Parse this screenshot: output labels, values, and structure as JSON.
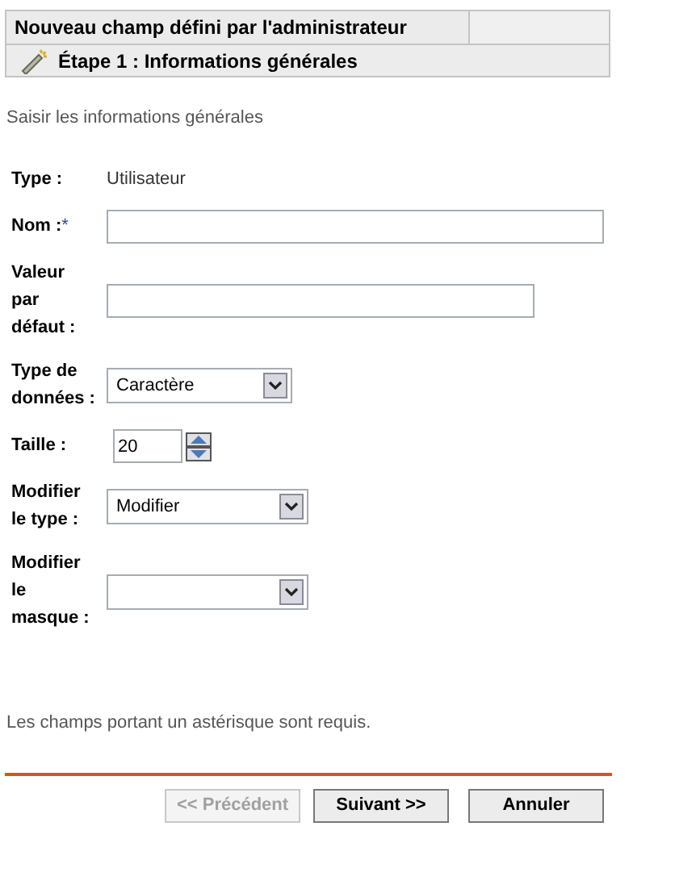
{
  "header": {
    "title": "Nouveau champ défini par l'administrateur",
    "step": "Étape 1 : Informations générales"
  },
  "instructions": "Saisir les informations générales",
  "fields": [
    {
      "kind": "text",
      "label": "Type :",
      "value": "Utilisateur"
    },
    {
      "kind": "input",
      "label": "Nom :",
      "required_mark": "*"
    },
    {
      "kind": "input",
      "label": "Valeur par défaut :"
    },
    {
      "kind": "select",
      "label": "Type de données :",
      "value": "Caractère"
    },
    {
      "kind": "spinner",
      "label": "Taille :",
      "value": "20"
    },
    {
      "kind": "select",
      "label": "Modifier le type :",
      "value": "Modifier"
    },
    {
      "kind": "select",
      "label": "Modifier le masque :"
    }
  ],
  "required_note": "Les champs portant un astérisque sont requis.",
  "buttons": [
    {
      "label": "<< Précédent",
      "disabled": true
    },
    {
      "label": "Suivant >>",
      "disabled": false
    },
    {
      "label": "Annuler",
      "disabled": false
    }
  ]
}
